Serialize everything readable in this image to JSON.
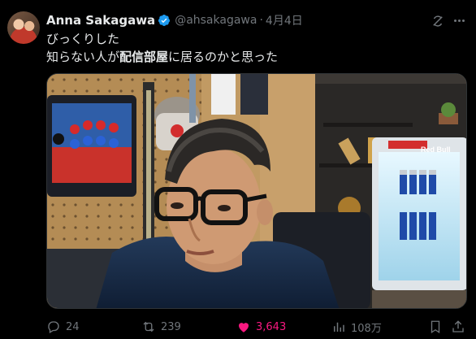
{
  "tweet": {
    "author_name": "Anna Sakagawa",
    "handle": "@ahsakagawa",
    "separator": "·",
    "date": "4月4日",
    "line1": "びっくりした",
    "line2_before": "知らない人が",
    "line2_bold": "配信部屋",
    "line2_after": "に居るのかと思った"
  },
  "media": {
    "can_label": "Red Bull"
  },
  "actions": {
    "replies": "24",
    "reposts": "239",
    "likes": "3,643",
    "views": "108万"
  },
  "colors": {
    "background": "#000000",
    "text": "#e7e9ea",
    "muted": "#71767b",
    "verified": "#1d9bf0",
    "like": "#f91880"
  },
  "icons": [
    "verified-badge-icon",
    "grok-icon",
    "more-icon",
    "reply-icon",
    "repost-icon",
    "heart-icon",
    "views-icon",
    "bookmark-icon",
    "share-icon"
  ]
}
